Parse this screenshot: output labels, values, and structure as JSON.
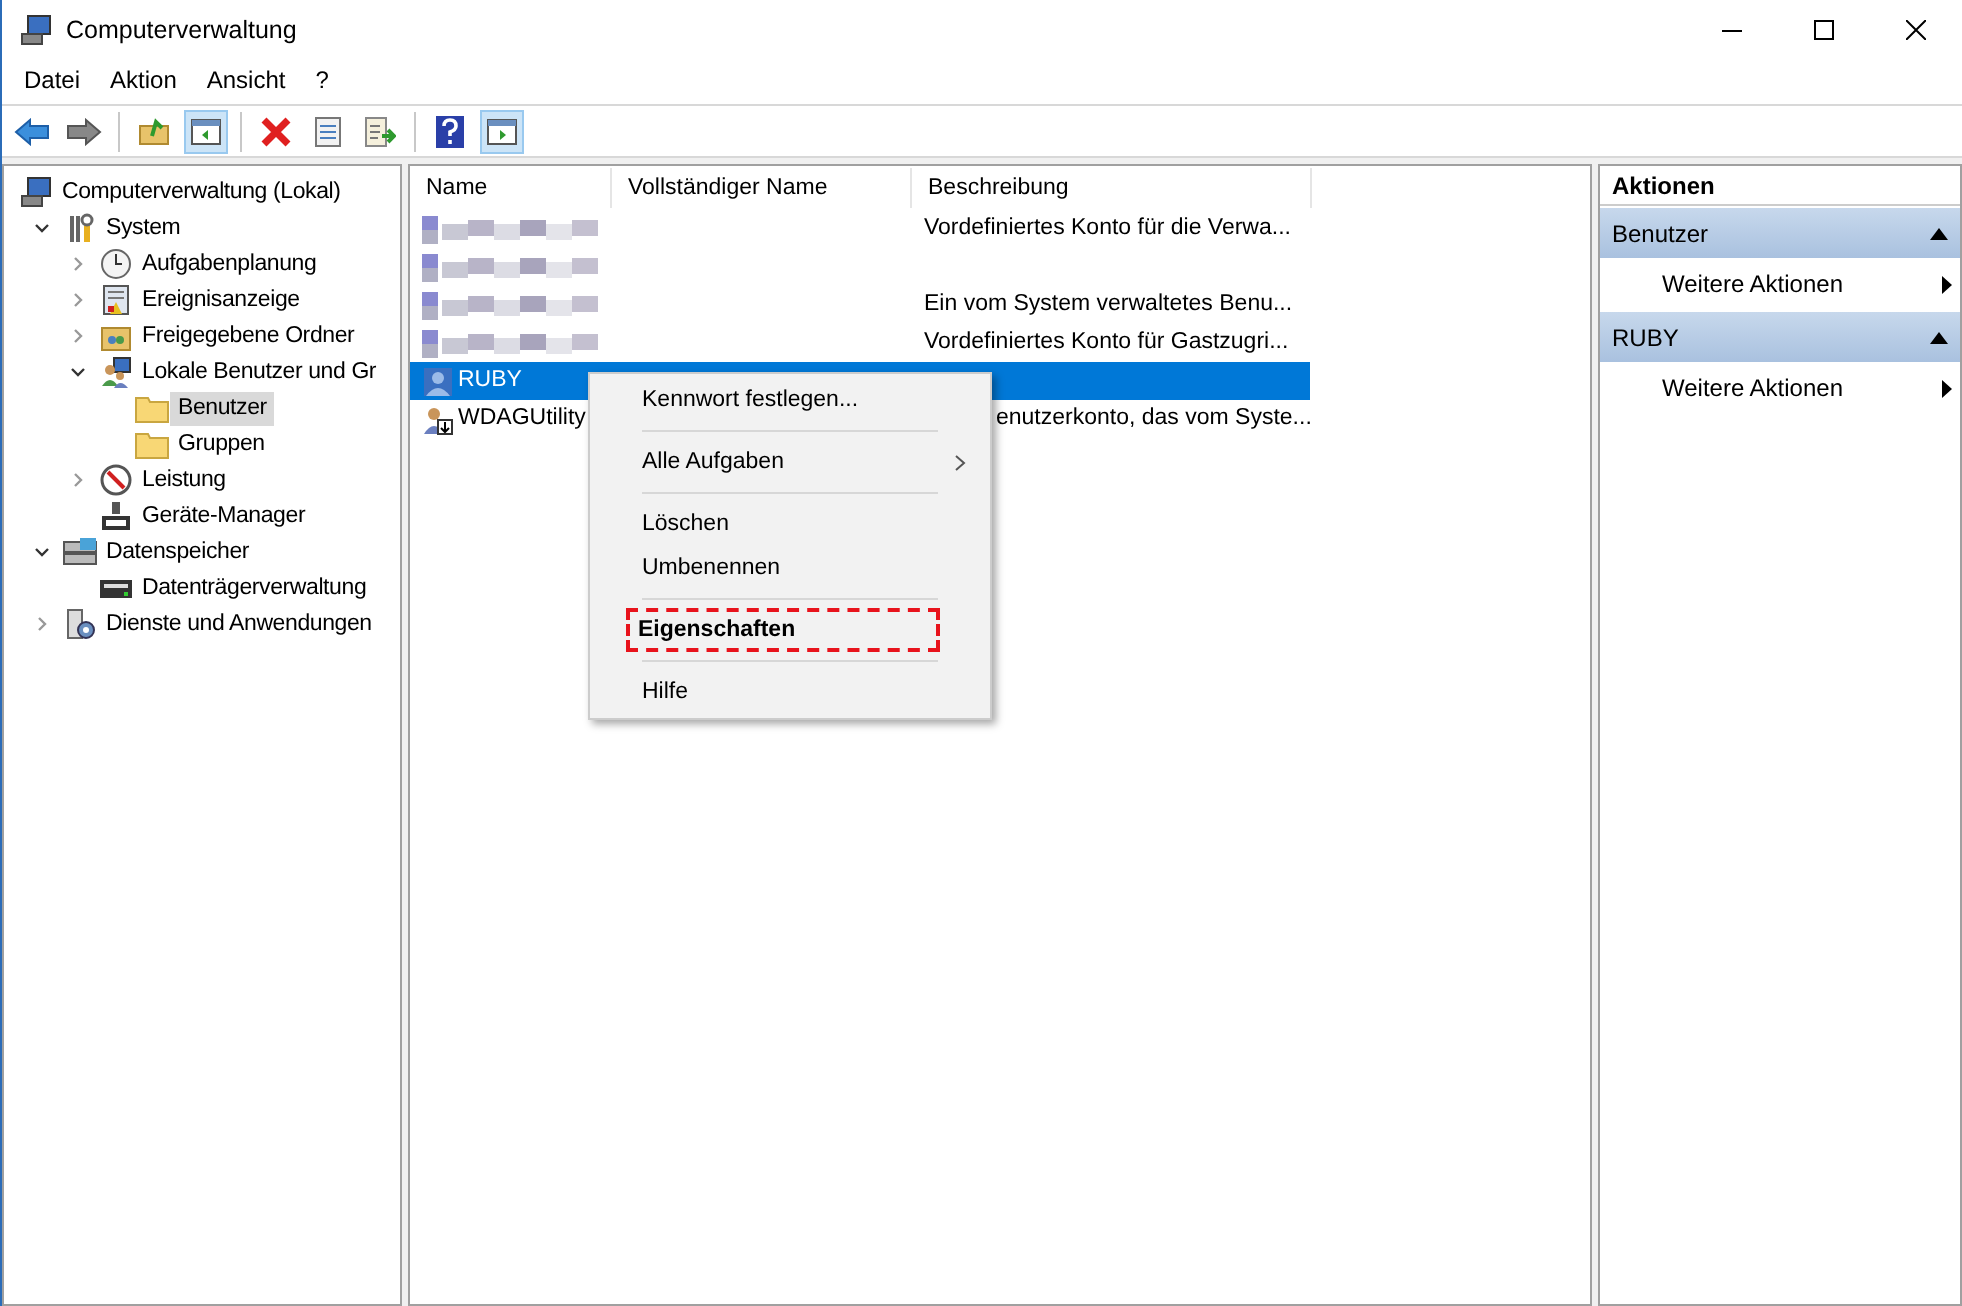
{
  "window": {
    "title": "Computerverwaltung"
  },
  "menu": [
    "Datei",
    "Aktion",
    "Ansicht",
    "?"
  ],
  "toolbar": [
    {
      "kind": "back",
      "selected": false
    },
    {
      "kind": "forward",
      "selected": false
    },
    {
      "kind": "sep"
    },
    {
      "kind": "up",
      "selected": false
    },
    {
      "kind": "tree",
      "selected": true
    },
    {
      "kind": "sep"
    },
    {
      "kind": "delete",
      "selected": false
    },
    {
      "kind": "props",
      "selected": false
    },
    {
      "kind": "export",
      "selected": false
    },
    {
      "kind": "sep"
    },
    {
      "kind": "help",
      "selected": false
    },
    {
      "kind": "actionpane",
      "selected": true
    }
  ],
  "tree": [
    {
      "label": "Computerverwaltung (Lokal)",
      "kind": "computer",
      "selected": false,
      "children": [
        {
          "label": "System",
          "kind": "tools",
          "expanded": true,
          "selected": false,
          "children": [
            {
              "label": "Aufgabenplanung",
              "kind": "clock",
              "expanded": false,
              "selected": false
            },
            {
              "label": "Ereignisanzeige",
              "kind": "log",
              "expanded": false,
              "selected": false
            },
            {
              "label": "Freigegebene Ordner",
              "kind": "share",
              "expanded": false,
              "selected": false
            },
            {
              "label": "Lokale Benutzer und Gr",
              "kind": "users",
              "expanded": true,
              "selected": false,
              "children": [
                {
                  "label": "Benutzer",
                  "kind": "folder",
                  "selected": true
                },
                {
                  "label": "Gruppen",
                  "kind": "folder",
                  "selected": false
                }
              ]
            },
            {
              "label": "Leistung",
              "kind": "gauge",
              "expanded": false,
              "selected": false
            },
            {
              "label": "Geräte-Manager",
              "kind": "device",
              "selected": false
            }
          ]
        },
        {
          "label": "Datenspeicher",
          "kind": "storage",
          "expanded": true,
          "selected": false,
          "children": [
            {
              "label": "Datenträgerverwaltung",
              "kind": "disk",
              "selected": false
            }
          ]
        },
        {
          "label": "Dienste und Anwendungen",
          "kind": "services",
          "expanded": false,
          "selected": false
        }
      ]
    }
  ],
  "table": {
    "columns": [
      "Name",
      "Vollständiger Name",
      "Beschreibung"
    ],
    "rows": [
      {
        "kind": "redacted",
        "description": "Vordefiniertes Konto für die Verwa...",
        "selected": false
      },
      {
        "kind": "redacted",
        "selected": false
      },
      {
        "kind": "redacted",
        "description": "Ein vom System verwaltetes Benu...",
        "selected": false
      },
      {
        "kind": "redacted",
        "description": "Vordefiniertes Konto für Gastzugri...",
        "selected": false
      },
      {
        "kind": "user",
        "name": "RUBY",
        "selected": true
      },
      {
        "kind": "covered",
        "name": "WDAGUtility",
        "description": "enutzerkonto, das vom Syste...",
        "selected": false
      }
    ]
  },
  "context_menu": [
    {
      "kind": "item",
      "label": "Kennwort festlegen...",
      "highlighted": false
    },
    {
      "kind": "sep"
    },
    {
      "kind": "submenu",
      "label": "Alle Aufgaben",
      "highlighted": false
    },
    {
      "kind": "sep"
    },
    {
      "kind": "item",
      "label": "Löschen",
      "highlighted": false
    },
    {
      "kind": "item",
      "label": "Umbenennen",
      "highlighted": false
    },
    {
      "kind": "sep"
    },
    {
      "kind": "item",
      "label": "Eigenschaften",
      "highlighted": true
    },
    {
      "kind": "sep"
    },
    {
      "kind": "item",
      "label": "Hilfe",
      "highlighted": false
    }
  ],
  "actions": {
    "title": "Aktionen",
    "sections": [
      {
        "title": "Benutzer",
        "expanded": true,
        "items": [
          "Weitere Aktionen"
        ]
      },
      {
        "title": "RUBY",
        "expanded": true,
        "items": [
          "Weitere Aktionen"
        ]
      }
    ]
  }
}
